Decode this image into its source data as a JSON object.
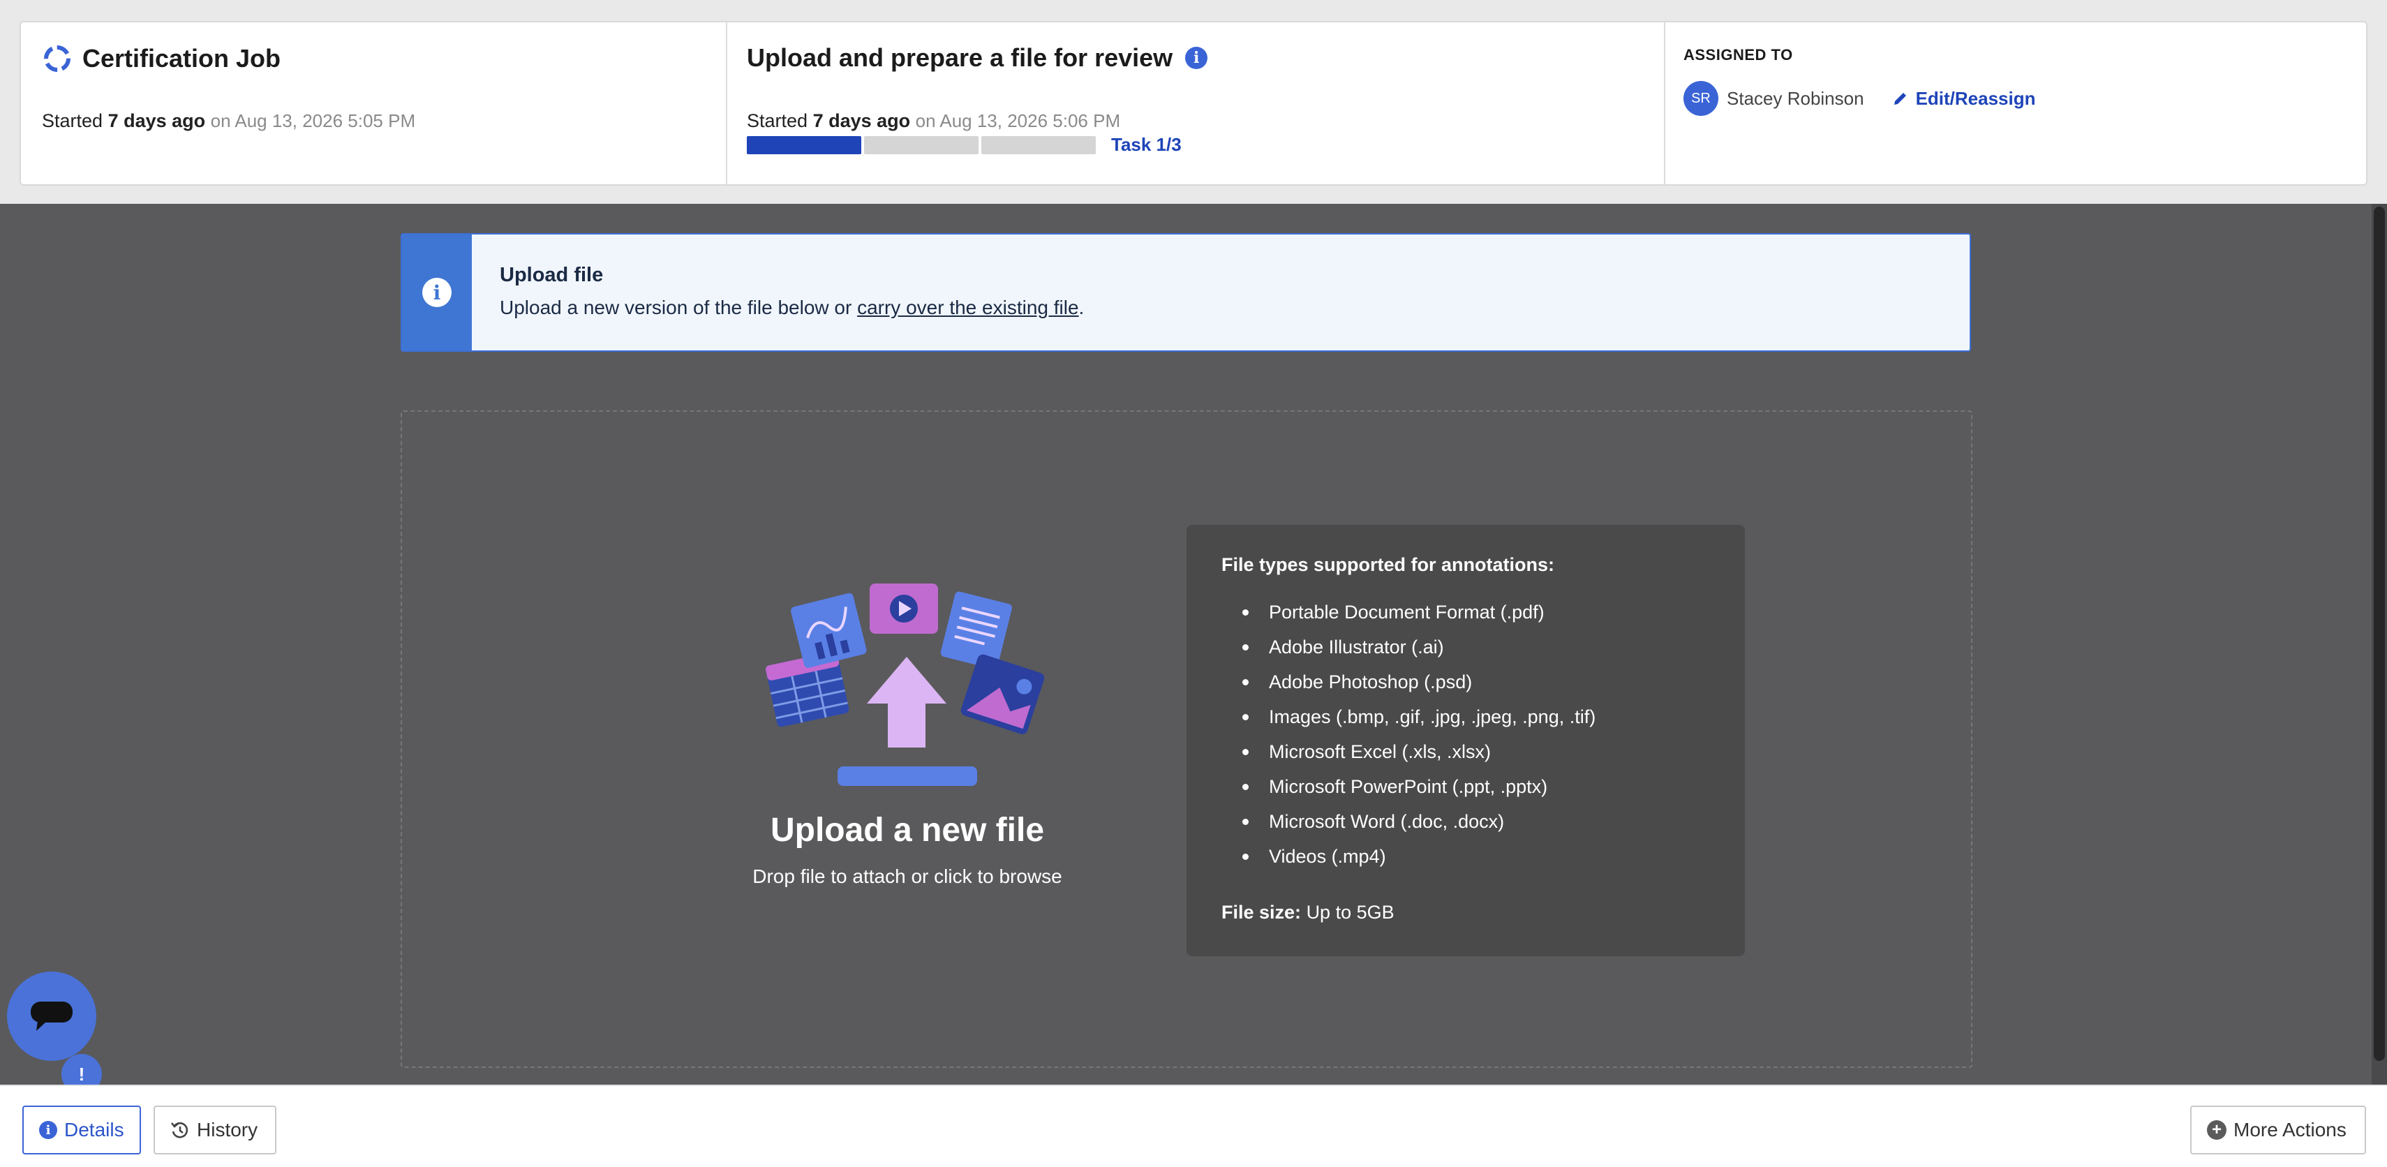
{
  "job": {
    "title": "Certification Job",
    "started_prefix": "Started",
    "started_relative": "7 days ago",
    "started_absolute": "on Aug 13, 2026 5:05 PM"
  },
  "task": {
    "title": "Upload and prepare a file for review",
    "info_icon": "i",
    "started_prefix": "Started",
    "started_relative": "7 days ago",
    "started_absolute": "on Aug 13, 2026 5:06 PM",
    "progress_total": 3,
    "progress_current": 1,
    "task_count_label": "Task 1/3"
  },
  "assignment": {
    "label": "ASSIGNED TO",
    "avatar_initials": "SR",
    "assignee_name": "Stacey Robinson",
    "edit_label": "Edit/Reassign"
  },
  "banner": {
    "icon": "i",
    "title": "Upload file",
    "text_before": "Upload a new version of the file below or ",
    "link_text": "carry over the existing file",
    "text_after": "."
  },
  "dropzone": {
    "title": "Upload a new file",
    "subtitle": "Drop file to attach or click to browse"
  },
  "file_types": {
    "heading": "File types supported for annotations:",
    "items": [
      "Portable Document Format (.pdf)",
      "Adobe Illustrator (.ai)",
      "Adobe Photoshop (.psd)",
      "Images (.bmp, .gif, .jpg, .jpeg, .png, .tif)",
      "Microsoft Excel (.xls, .xlsx)",
      "Microsoft PowerPoint (.ppt, .pptx)",
      "Microsoft Word (.doc, .docx)",
      "Videos (.mp4)"
    ],
    "size_label": "File size:",
    "size_value": "Up to 5GB"
  },
  "chat": {
    "badge": "!"
  },
  "footer": {
    "details_label": "Details",
    "details_icon": "i",
    "history_label": "History",
    "more_label": "More Actions",
    "more_icon": "+"
  },
  "colors": {
    "accent": "#1e44b8",
    "banner_side": "#3f76d3",
    "background": "#5a5a5c"
  }
}
